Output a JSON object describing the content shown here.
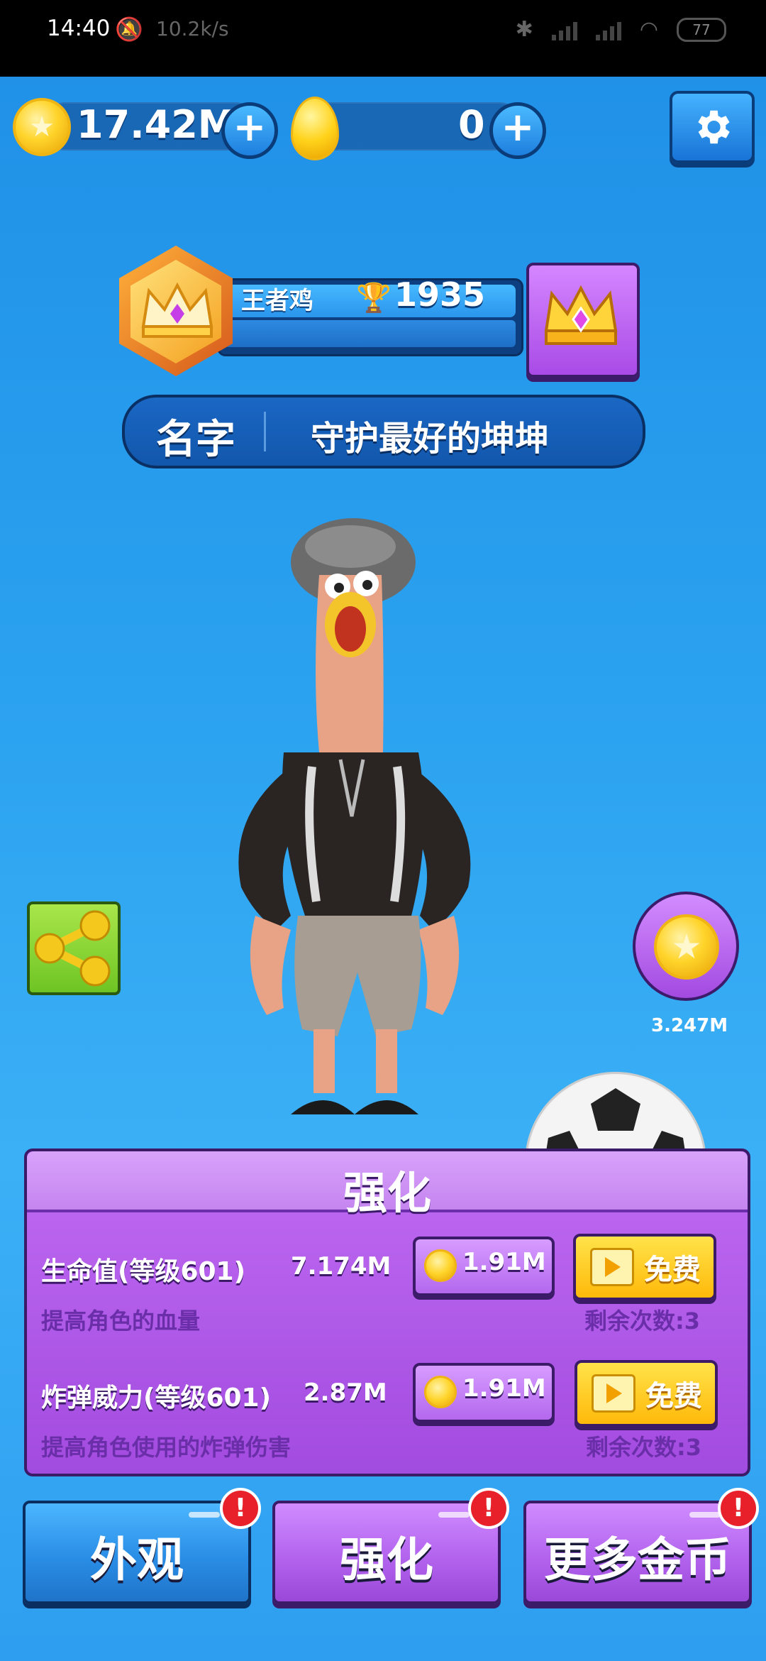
{
  "status_bar": {
    "time": "14:40",
    "net_speed": "10.2k/s",
    "battery": "77"
  },
  "currency": {
    "coins": "17.42M",
    "eggs": "0",
    "coin_icon": "gold-coin-icon",
    "egg_icon": "golden-egg-icon"
  },
  "rank": {
    "title": "王者鸡",
    "score": "1935"
  },
  "name_bar": {
    "label": "名字",
    "value": "守护最好的坤坤"
  },
  "coin_bubble": {
    "amount": "3.247M"
  },
  "upgrade_panel": {
    "title": "强化",
    "items": [
      {
        "name": "生命值(等级601)",
        "value": "7.174M",
        "description": "提高角色的血量",
        "cost": "1.91M",
        "free_label": "免费",
        "remaining": "剩余次数:3"
      },
      {
        "name": "炸弹威力(等级601)",
        "value": "2.87M",
        "description": "提高角色使用的炸弹伤害",
        "cost": "1.91M",
        "free_label": "免费",
        "remaining": "剩余次数:3"
      }
    ]
  },
  "tabs": [
    {
      "label": "外观",
      "badge": "!"
    },
    {
      "label": "强化",
      "badge": "!"
    },
    {
      "label": "更多金币",
      "badge": "!"
    }
  ],
  "colors": {
    "background": "#2aa1ef",
    "panel": "#a24bdf",
    "tab_blue": "#2a8ee6",
    "tab_purple": "#b364ee",
    "badge_red": "#e8202a",
    "free_yellow": "#ffc51a"
  }
}
